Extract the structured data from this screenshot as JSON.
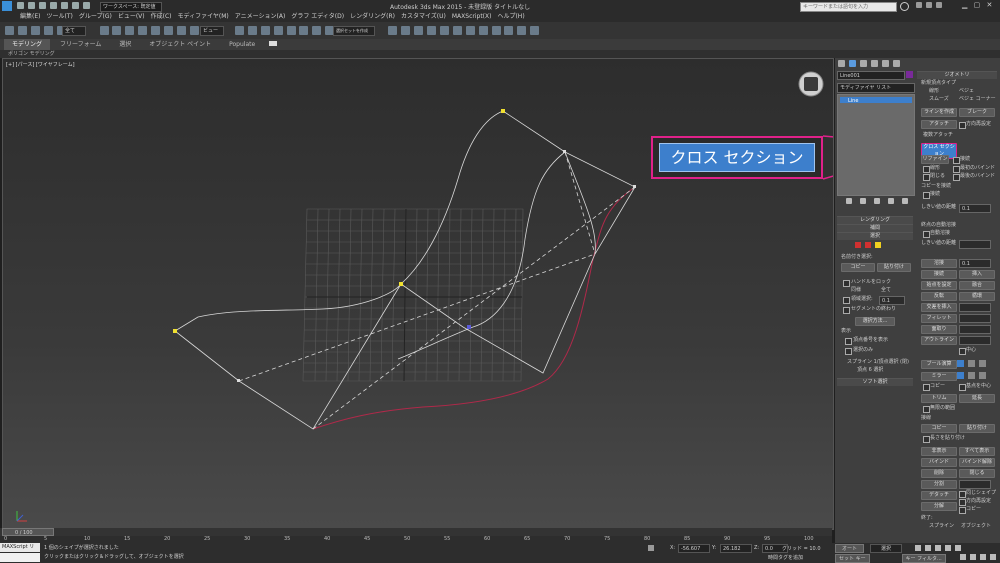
{
  "titlebar": {
    "workspace": "ワークスペース: 既定値",
    "title": "Autodesk 3ds Max 2015 - 未登録版 タイトルなし",
    "search_placeholder": "キーワードまたは語句を入力"
  },
  "menu": [
    "編集(E)",
    "ツール(T)",
    "グループ(G)",
    "ビュー(V)",
    "作成(C)",
    "モディファイヤ(M)",
    "アニメーション(A)",
    "グラフ エディタ(D)",
    "レンダリング(R)",
    "カスタマイズ(U)",
    "MAXScript(X)",
    "ヘルプ(H)"
  ],
  "toolbar": {
    "selection_filter": "全て",
    "view": "ビュー",
    "selection_set": "選択セットを作成"
  },
  "ribbon": {
    "tabs": [
      "モデリング",
      "フリーフォーム",
      "選択",
      "オブジェクト ペイント",
      "Populate"
    ],
    "subtab": "ポリゴン モデリング"
  },
  "viewport": {
    "label": "[+] [パース] [ワイヤフレーム]"
  },
  "callout": {
    "label": "クロス セクション",
    "accent": "#e0218a",
    "button_color": "#3d7fcc"
  },
  "panel": {
    "object_name": "Line001",
    "modifier_list": "モディファイヤ リスト",
    "stack_item": "Line",
    "rollouts": {
      "rendering": "レンダリング",
      "interpolation": "補間",
      "selection": "選択",
      "soft_selection": "ソフト選択",
      "geometry": "ジオメトリ"
    },
    "selection": {
      "named_selection": "名前付き選択:",
      "copy": "コピー",
      "paste": "貼り付け",
      "lock_handles": "ハンドルをロック",
      "alike": "同様",
      "all": "全て",
      "area_selection": "領域選択:",
      "area_value": "0.1",
      "segment_end": "セグメントの終わり",
      "select_by": "選択方法...",
      "display": "表示",
      "show_vertex_numbers": "頂点番号を表示",
      "selected_only": "選択のみ",
      "status_line1": "スプライン 1/頂点選択 (閉)",
      "status_line2": "頂点 6 選択"
    },
    "geometry": {
      "new_vertex_type": "新規頂点タイプ",
      "linear": "線形",
      "bezier": "ベジェ",
      "smooth": "スムーズ",
      "bezier_corner": "ベジェ コーナー",
      "create_line": "ラインを作成",
      "break": "ブレーク",
      "attach": "アタッチ",
      "reorient": "方向再設定",
      "attach_mult": "複数アタッチ",
      "cross_section": "クロス セクション",
      "refine": "リファイン",
      "connect": "接続",
      "linear2": "線形",
      "bind_first": "最初のバインド",
      "closed": "閉じる",
      "bind_last": "最後のバインド",
      "connect_copy": "コピーを接続",
      "connect_on": "接続",
      "threshold_distance": "しきい値の距離",
      "threshold_value": "0.1",
      "end_point_auto_welding": "終点の自動溶接",
      "automatic_welding": "自動溶接",
      "threshold_distance2": "しきい値の距離",
      "weld": "溶接",
      "weld_value": "0.1",
      "connect_btn": "接続",
      "insert": "挿入",
      "make_first": "始点を設定",
      "fuse": "融合",
      "reverse": "反転",
      "cycle": "循環",
      "cross_insert": "交差を挿入",
      "fillet": "フィレット",
      "chamfer": "面取り",
      "outline": "アウトライン",
      "center": "中心",
      "boolean": "ブール演算",
      "mirror": "ミラー",
      "copy": "コピー",
      "about_pivot": "基点を中心",
      "trim": "トリム",
      "extend": "延長",
      "infinite_bounds": "無限の範囲",
      "tangent": "接線",
      "copy2": "コピー",
      "paste2": "貼り付け",
      "paste_length": "長さを貼り付け",
      "hide": "非表示",
      "unhide_all": "すべて表示",
      "bind": "バインド",
      "unbind": "バインド解除",
      "delete": "削除",
      "close": "閉じる",
      "divide": "分割",
      "detach": "デタッチ",
      "same_shape": "同じシェイプ",
      "reorient2": "方向再設定",
      "copy3": "コピー",
      "explode": "分解",
      "to": "終了:",
      "splines": "スプライン",
      "objects": "オブジェクト"
    }
  },
  "timeline": {
    "frame_display": "0 / 100",
    "ticks": [
      "0",
      "5",
      "10",
      "15",
      "20",
      "25",
      "30",
      "35",
      "40",
      "45",
      "50",
      "55",
      "60",
      "65",
      "70",
      "75",
      "80",
      "85",
      "90",
      "95",
      "100"
    ]
  },
  "status": {
    "script_label": "MAXScript リ",
    "line1": "1 個のシェイプが選択されました",
    "line2": "クリックまたはクリック＆ドラッグして、オブジェクトを選択",
    "x_label": "X:",
    "x_value": "-56.607",
    "y_label": "Y:",
    "y_value": "26.182",
    "z_label": "Z:",
    "z_value": "0.0",
    "grid": "グリッド = 10.0",
    "add_time_tag": "時間タグを追加",
    "auto_key": "オート",
    "selected": "選択",
    "set_key": "セット キー",
    "key_filters": "キー フィルタ..."
  }
}
